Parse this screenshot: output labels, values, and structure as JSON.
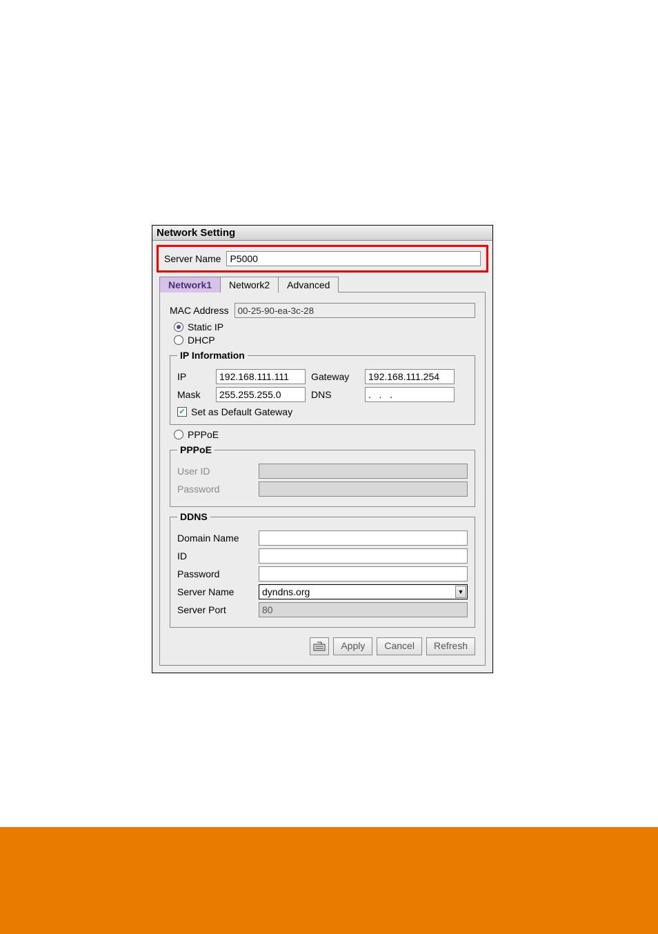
{
  "window": {
    "title": "Network Setting"
  },
  "server": {
    "label": "Server Name",
    "value": "P5000"
  },
  "tabs": {
    "network1": "Network1",
    "network2": "Network2",
    "advanced": "Advanced"
  },
  "mac": {
    "label": "MAC Address",
    "value": "00-25-90-ea-3c-28"
  },
  "modes": {
    "static": "Static IP",
    "dhcp": "DHCP",
    "pppoe": "PPPoE"
  },
  "ipinfo": {
    "legend": "IP Information",
    "ip_label": "IP",
    "ip_value": "192.168.111.111",
    "gateway_label": "Gateway",
    "gateway_value": "192.168.111.254",
    "mask_label": "Mask",
    "mask_value": "255.255.255.0",
    "dns_label": "DNS",
    "dns_value": ".   .   .",
    "default_gw": "Set as Default Gateway"
  },
  "pppoe": {
    "legend": "PPPoE",
    "user_label": "User ID",
    "user_value": "",
    "pass_label": "Password",
    "pass_value": ""
  },
  "ddns": {
    "legend": "DDNS",
    "domain_label": "Domain Name",
    "domain_value": "",
    "id_label": "ID",
    "id_value": "",
    "pass_label": "Password",
    "pass_value": "",
    "server_label": "Server Name",
    "server_value": "dyndns.org",
    "port_label": "Server Port",
    "port_value": "80"
  },
  "buttons": {
    "apply": "Apply",
    "cancel": "Cancel",
    "refresh": "Refresh"
  }
}
